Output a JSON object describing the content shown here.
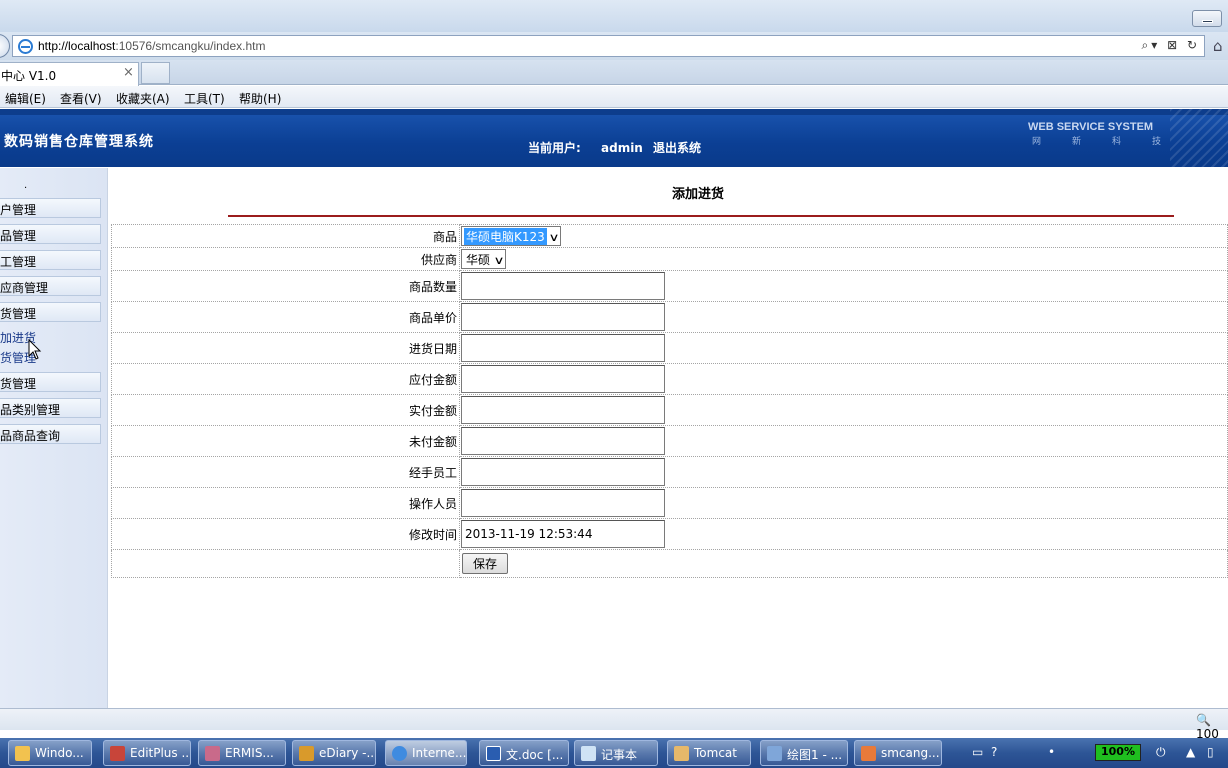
{
  "browser": {
    "url_host": "http://localhost",
    "url_rest": ":10576/smcangku/index.htm",
    "tab_title": "中心 V1.0",
    "tab_close": "×",
    "menu": [
      "编辑(E)",
      "查看(V)",
      "收藏夹(A)",
      "工具(T)",
      "帮助(H)"
    ],
    "zoom": "100"
  },
  "header": {
    "title": "数码销售仓库管理系统",
    "user_label": "当前用户:",
    "username": "admin",
    "logout": "退出系统",
    "brand": "WEB SERVICE SYSTEM",
    "brand_sub": "网新科技"
  },
  "sidebar": {
    "dot": ".",
    "items": [
      "户管理",
      "品管理",
      "工管理",
      "应商管理",
      "货管理"
    ],
    "sublinks": [
      "加进货",
      "货管理"
    ],
    "items2": [
      "货管理",
      "品类别管理",
      "品商品查询"
    ]
  },
  "form": {
    "heading": "添加进货",
    "product_label": "商品",
    "product_value": "华硕电脑K123",
    "supplier_label": "供应商",
    "supplier_value": "华硕",
    "quantity_label": "商品数量",
    "price_label": "商品单价",
    "date_label": "进货日期",
    "payable_label": "应付金额",
    "paid_label": "实付金额",
    "unpaid_label": "未付金额",
    "handler_label": "经手员工",
    "operator_label": "操作人员",
    "modified_label": "修改时间",
    "modified_value": "2013-11-19 12:53:44",
    "save_label": "保存"
  },
  "taskbar": {
    "tasks": [
      "Windo...",
      "EditPlus ...",
      "ERMIS...",
      "eDiary -...",
      "Interne...",
      "文.doc [...",
      "记事本",
      "Tomcat",
      "绘图1 - ...",
      "smcang..."
    ],
    "battery": "100%"
  }
}
